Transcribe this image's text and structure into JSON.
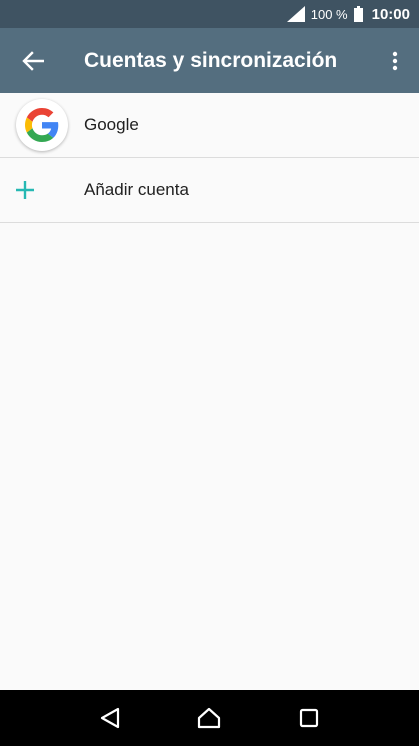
{
  "status_bar": {
    "battery_percent": "100 %",
    "time": "10:00",
    "icons": [
      "signal-icon",
      "battery-icon"
    ]
  },
  "app_bar": {
    "title": "Cuentas y sincronización",
    "back_icon": "arrow-back-icon",
    "menu_icon": "more-vert-icon"
  },
  "accounts": [
    {
      "label": "Google",
      "icon": "google-logo-icon"
    },
    {
      "label": "Añadir cuenta",
      "icon": "plus-icon"
    }
  ],
  "colors": {
    "status_bar": "#3f5362",
    "app_bar": "#546e7f",
    "accent": "#26b8b3",
    "background": "#fafafa"
  },
  "nav_bar": {
    "icons": [
      "back-triangle-icon",
      "home-icon",
      "recents-icon"
    ]
  }
}
